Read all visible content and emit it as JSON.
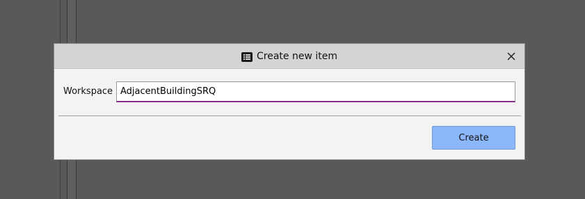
{
  "dialog": {
    "title": "Create new item",
    "title_icon": "list-icon",
    "close_icon": "close-icon"
  },
  "form": {
    "workspace_label": "Workspace",
    "workspace_value": "AdjacentBuildingSRQ"
  },
  "actions": {
    "create_label": "Create"
  },
  "colors": {
    "backdrop": "#595959",
    "dialog_bg": "#f3f3f3",
    "titlebar_bg": "#d4d4d4",
    "input_focus_underline": "#8b2a8b",
    "primary_button": "#8cb8fb"
  }
}
